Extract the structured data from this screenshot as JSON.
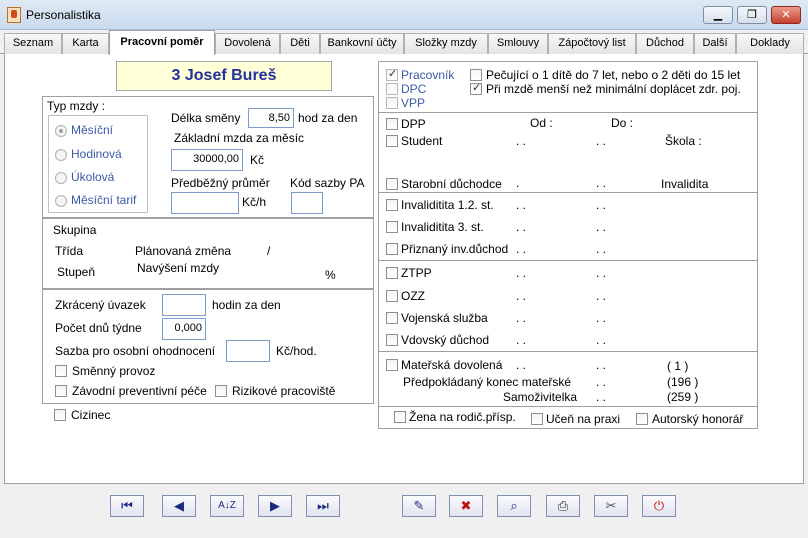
{
  "window": {
    "title": "Personalistika",
    "minimize": "▁",
    "maximize": "❐",
    "close": "✕"
  },
  "tabs": [
    {
      "label": "Seznam"
    },
    {
      "label": "Karta"
    },
    {
      "label": "Pracovní poměr"
    },
    {
      "label": "Dovolená"
    },
    {
      "label": "Děti"
    },
    {
      "label": "Bankovní účty"
    },
    {
      "label": "Složky mzdy"
    },
    {
      "label": "Smlouvy"
    },
    {
      "label": "Zápočtový list"
    },
    {
      "label": "Důchod"
    },
    {
      "label": "Další"
    },
    {
      "label": "Doklady"
    }
  ],
  "employee": {
    "name": "3 Josef Bureš"
  },
  "typ_mzdy": {
    "title": "Typ mzdy :",
    "options": [
      {
        "label": "Měsíční"
      },
      {
        "label": "Hodinová"
      },
      {
        "label": "Úkolová"
      },
      {
        "label": "Měsíční tarif"
      }
    ],
    "delka_smeny_label": "Délka směny",
    "delka_smeny_value": "8,50",
    "delka_smeny_unit": "hod za den",
    "zakladni_mzda_label": "Základní mzda za měsíc",
    "zakladni_mzda_value": "30000,00",
    "zakladni_mzda_unit": "Kč",
    "predbezny_prumer_label": "Předběžný průměr",
    "predbezny_prumer_unit": "Kč/h",
    "kod_sazby_label": "Kód sazby PA"
  },
  "skupina": {
    "skupina_label": "Skupina",
    "trida_label": "Třída",
    "planovana_zmena_label": "Plánovaná změna",
    "slash": "/",
    "stupen_label": "Stupeň",
    "navyseni_label": "Navýšení mzdy",
    "percent": "%"
  },
  "uvazek": {
    "zkraceny_label": "Zkrácený úvazek",
    "zkraceny_unit": "hodin za den",
    "pocet_dnu_label": "Počet dnů týdne",
    "pocet_dnu_value": "0,000",
    "sazba_label": "Sazba pro osobní ohodnocení",
    "sazba_unit": "Kč/hod.",
    "smenny_label": "Směnný provoz",
    "zavodni_label": "Závodní preventivní péče",
    "rizikove_label": "Rizikové pracoviště"
  },
  "cizinec_label": "Cizinec",
  "right": {
    "pracovnik": "Pracovník",
    "dpc": "DPC",
    "vpp": "VPP",
    "pecujici": "Pečující o 1 dítě do 7 let, nebo o 2 děti do 15 let",
    "pri_mzde": "Při mzdě menší než minimální doplácet zdr. poj.",
    "dpp": "DPP",
    "od": "Od :",
    "do": "Do :",
    "student": "Student",
    "skola": "Škola :",
    "starobni": "Starobní důchodce",
    "invalidita": "Invalidita",
    "invalidita12": "Invaliditita 1.2. st.",
    "invalidita3": "Invaliditita 3. st.",
    "priznany": "Přiznaný inv.důchod",
    "ztpp": "ZTPP",
    "ozz": "OZZ",
    "vojenska": "Vojenská služba",
    "vdovsky": "Vdovský důchod",
    "materska": "Mateřská dovolená",
    "predpokladany": "Předpokládaný konec mateřské",
    "samozivitelka": "Samoživitelka",
    "paren1": "(         1 )",
    "paren2": "(196     )",
    "paren3": "(259     )",
    "zena": "Žena na rodič.přísp.",
    "ucen": "Učeň na praxi",
    "autorsky": "Autorský honorář",
    "dot": ".",
    "dots": ". ."
  },
  "toolbar": {
    "first": "⏮",
    "prev": "◀",
    "sort": "A↓Z",
    "next": "▶",
    "last": "⏭",
    "edit": "✎",
    "delete": "✖",
    "find": "⌕",
    "print": "⎙",
    "tools": "✂",
    "power": "⏻"
  }
}
